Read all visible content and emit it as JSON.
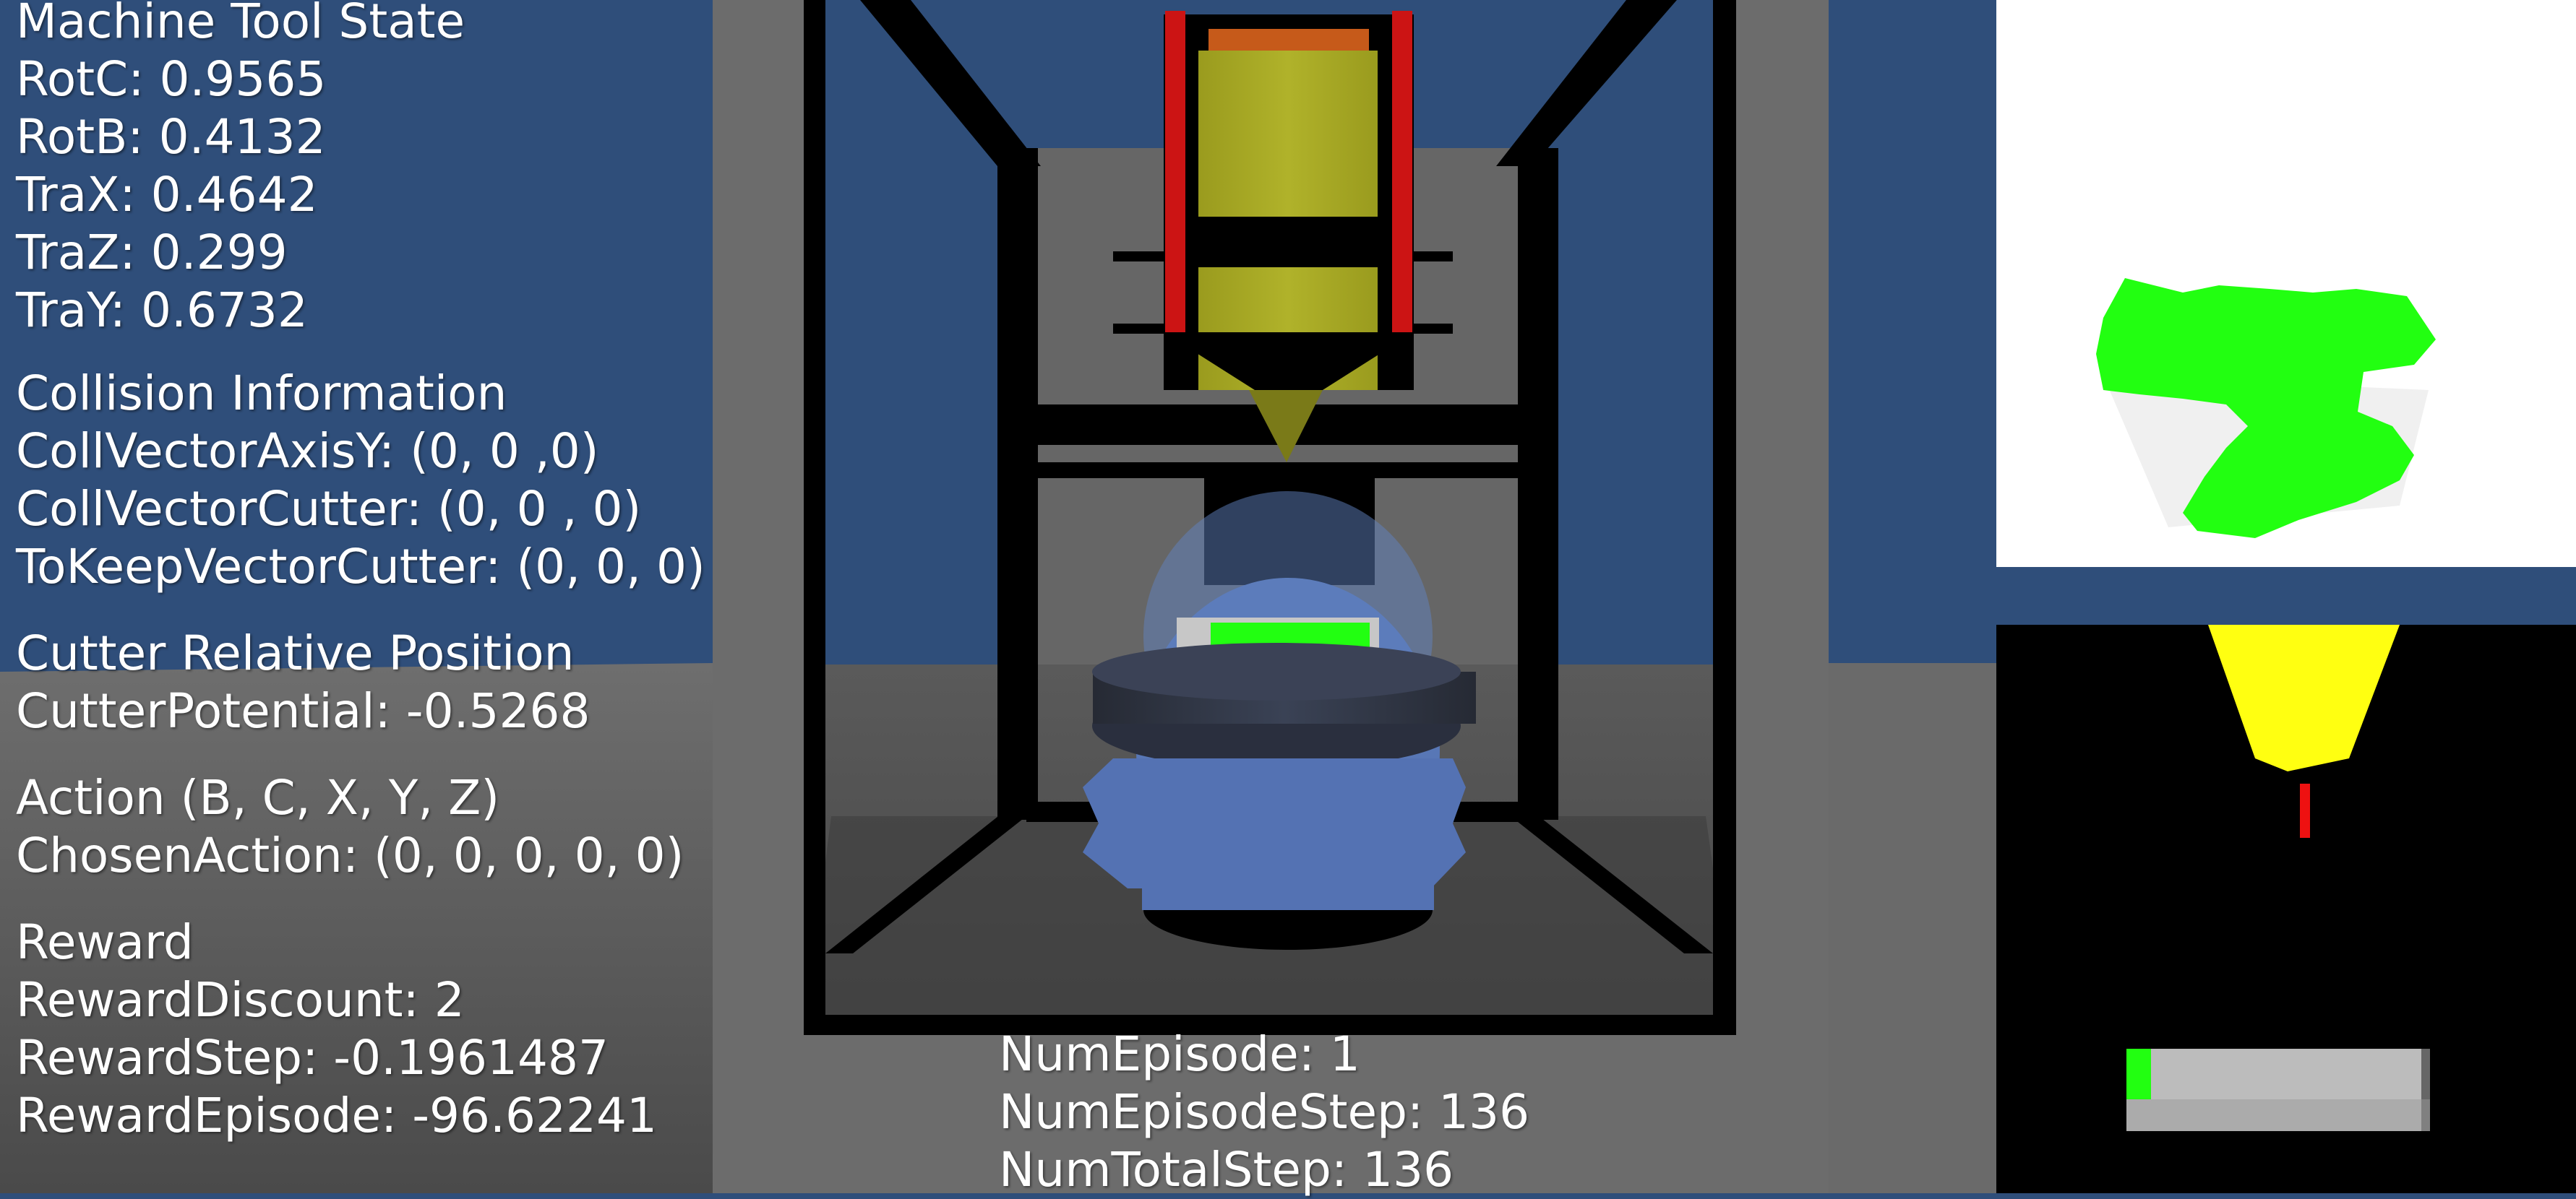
{
  "machine_tool_state": {
    "heading": "Machine Tool State",
    "items": [
      "RotC: 0.9565",
      "RotB: 0.4132",
      "TraX: 0.4642",
      "TraZ: 0.299",
      "TraY: 0.6732"
    ]
  },
  "collision_information": {
    "heading": "Collision Information",
    "items": [
      "CollVectorAxisY: (0, 0 ,0)",
      "CollVectorCutter: (0, 0 , 0)",
      "ToKeepVectorCutter: (0, 0, 0)"
    ]
  },
  "cutter_relative_position": {
    "heading": "Cutter Relative Position",
    "items": [
      "CutterPotential: -0.5268"
    ]
  },
  "action": {
    "heading": "Action (B, C, X, Y, Z)",
    "items": [
      "ChosenAction: (0, 0, 0, 0, 0)"
    ]
  },
  "reward": {
    "heading": "Reward",
    "items": [
      "RewardDiscount: 2",
      "RewardStep: -0.1961487",
      "RewardEpisode: -96.62241"
    ]
  },
  "episode_stats": {
    "num_episode": "NumEpisode: 1",
    "num_episode_step": "NumEpisodeStep: 136",
    "num_total_step": "NumTotalStep: 136"
  },
  "colors": {
    "sky_blue": "#2f4e7a",
    "floor_gray": "#6b6b6b",
    "cutter_yellow": "#a6a822",
    "machined_green": "#22ff11",
    "rail_red": "#cc1414"
  },
  "cutter_view_progress": 0.08
}
